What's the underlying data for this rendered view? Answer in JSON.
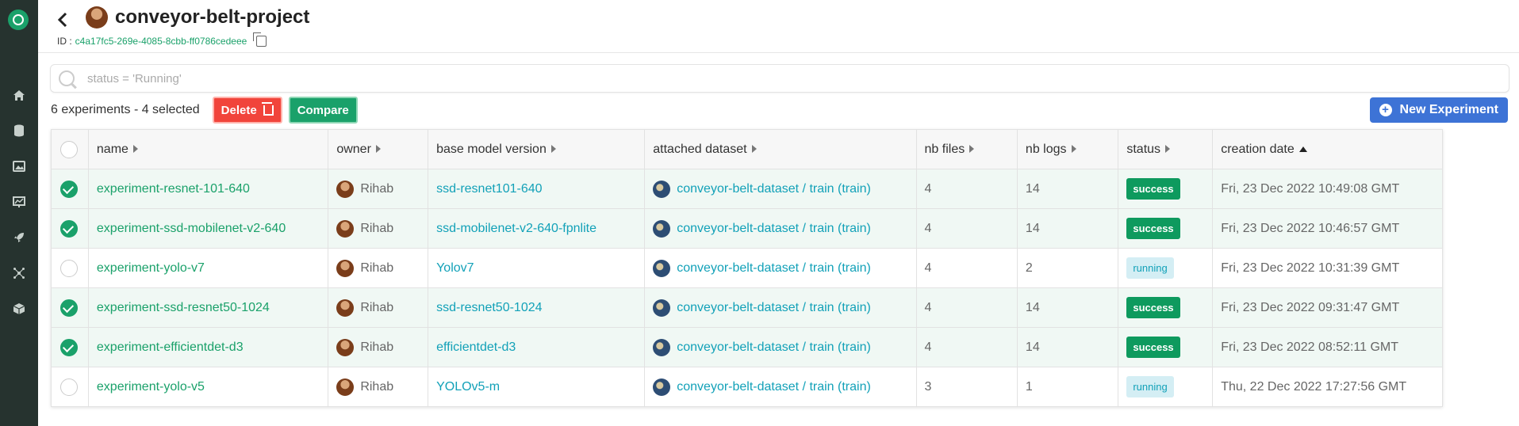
{
  "project": {
    "title": "conveyor-belt-project",
    "id_label": "ID :",
    "id_value": "c4a17fc5-269e-4085-8cbb-ff0786cedeee"
  },
  "search": {
    "placeholder": "status = 'Running'"
  },
  "toolbar": {
    "count_text": "6 experiments - 4 selected",
    "delete_label": "Delete",
    "compare_label": "Compare",
    "new_label": "New Experiment"
  },
  "table": {
    "columns": [
      "name",
      "owner",
      "base model version",
      "attached dataset",
      "nb files",
      "nb logs",
      "status",
      "creation date"
    ],
    "rows": [
      {
        "selected": true,
        "name": "experiment-resnet-101-640",
        "owner": "Rihab",
        "model": "ssd-resnet101-640",
        "dataset": "conveyor-belt-dataset / train (train)",
        "files": "4",
        "logs": "14",
        "status": "success",
        "date": "Fri, 23 Dec 2022 10:49:08 GMT"
      },
      {
        "selected": true,
        "name": "experiment-ssd-mobilenet-v2-640",
        "owner": "Rihab",
        "model": "ssd-mobilenet-v2-640-fpnlite",
        "dataset": "conveyor-belt-dataset / train (train)",
        "files": "4",
        "logs": "14",
        "status": "success",
        "date": "Fri, 23 Dec 2022 10:46:57 GMT"
      },
      {
        "selected": false,
        "name": "experiment-yolo-v7",
        "owner": "Rihab",
        "model": "Yolov7",
        "dataset": "conveyor-belt-dataset / train (train)",
        "files": "4",
        "logs": "2",
        "status": "running",
        "date": "Fri, 23 Dec 2022 10:31:39 GMT"
      },
      {
        "selected": true,
        "name": "experiment-ssd-resnet50-1024",
        "owner": "Rihab",
        "model": "ssd-resnet50-1024",
        "dataset": "conveyor-belt-dataset / train (train)",
        "files": "4",
        "logs": "14",
        "status": "success",
        "date": "Fri, 23 Dec 2022 09:31:47 GMT"
      },
      {
        "selected": true,
        "name": "experiment-efficientdet-d3",
        "owner": "Rihab",
        "model": "efficientdet-d3",
        "dataset": "conveyor-belt-dataset / train (train)",
        "files": "4",
        "logs": "14",
        "status": "success",
        "date": "Fri, 23 Dec 2022 08:52:11 GMT"
      },
      {
        "selected": false,
        "name": "experiment-yolo-v5",
        "owner": "Rihab",
        "model": "YOLOv5-m",
        "dataset": "conveyor-belt-dataset / train (train)",
        "files": "3",
        "logs": "1",
        "status": "running",
        "date": "Thu, 22 Dec 2022 17:27:56 GMT"
      }
    ]
  },
  "colors": {
    "accent": "#1aa16a",
    "link": "#12a1b8",
    "danger": "#f1443b",
    "primary": "#3d73d6",
    "rail": "#26332f"
  },
  "icons": [
    "app-logo-icon",
    "home-icon",
    "database-icon",
    "image-icon",
    "chart-icon",
    "rocket-icon",
    "network-icon",
    "cube-icon"
  ]
}
